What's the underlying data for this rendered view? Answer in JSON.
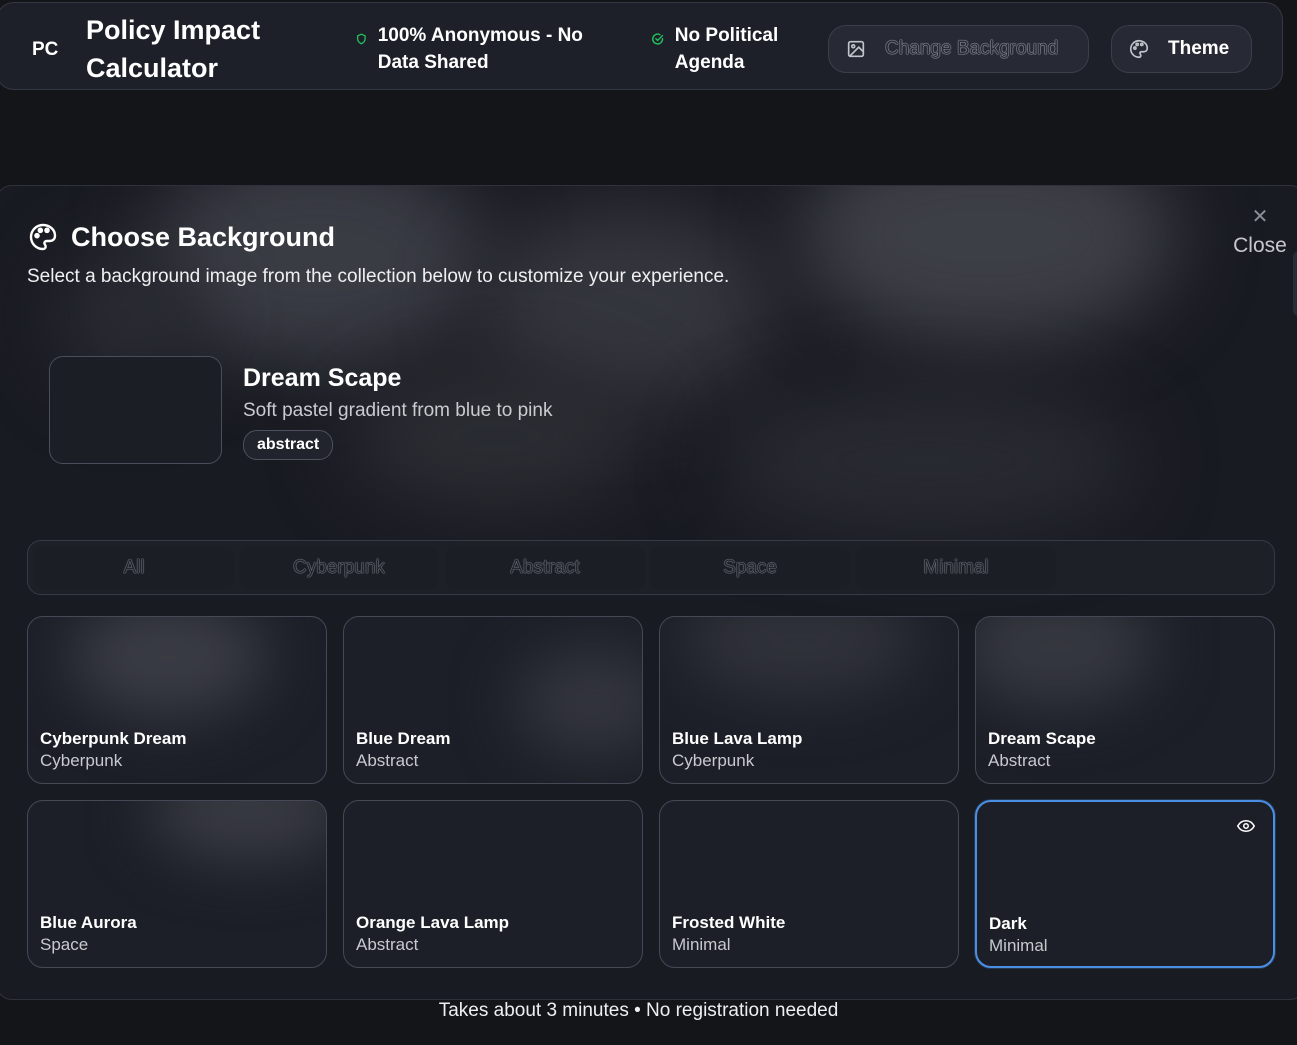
{
  "header": {
    "logo": "PC",
    "title": "Policy Impact Calculator",
    "badges": [
      {
        "icon": "shield-icon",
        "text": "100% Anonymous - No Data Shared"
      },
      {
        "icon": "check-circle-icon",
        "text": "No Political Agenda"
      }
    ],
    "change_background_label": "Change Background",
    "theme_label": "Theme",
    "badge_icon_color": "#22c55e"
  },
  "modal": {
    "title": "Choose Background",
    "subtitle": "Select a background image from the collection below to customize your experience.",
    "close_label": "Close",
    "preview": {
      "name": "Dream Scape",
      "description": "Soft pastel gradient from blue to pink",
      "tag": "abstract"
    },
    "tabs": [
      "All",
      "Cyberpunk",
      "Abstract",
      "Space",
      "Minimal"
    ],
    "backgrounds": [
      {
        "name": "Cyberpunk Dream",
        "category": "Cyberpunk"
      },
      {
        "name": "Blue Dream",
        "category": "Abstract"
      },
      {
        "name": "Blue Lava Lamp",
        "category": "Cyberpunk"
      },
      {
        "name": "Dream Scape",
        "category": "Abstract"
      },
      {
        "name": "Blue Aurora",
        "category": "Space"
      },
      {
        "name": "Orange Lava Lamp",
        "category": "Abstract"
      },
      {
        "name": "Frosted White",
        "category": "Minimal"
      },
      {
        "name": "Dark",
        "category": "Minimal",
        "selected": true
      }
    ],
    "selected_color": "#4b8fe4"
  },
  "footer": {
    "note": "Takes about 3 minutes • No registration needed"
  }
}
